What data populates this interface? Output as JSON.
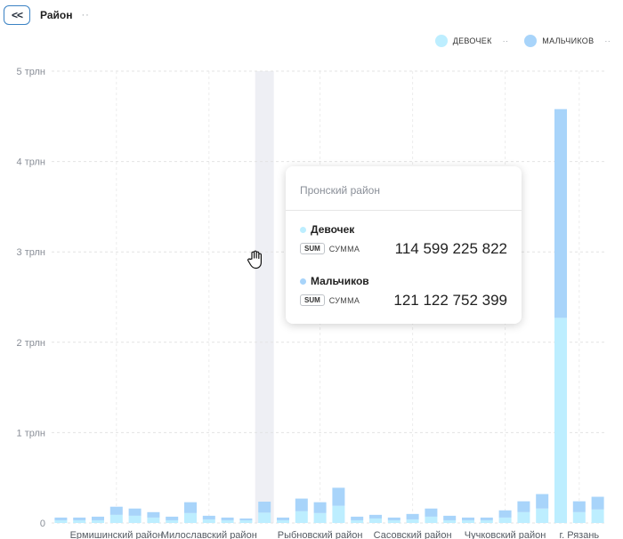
{
  "header": {
    "back_label": "<<",
    "title": "Район",
    "menu_dots": "··"
  },
  "legend": [
    {
      "name": "ДЕВОЧЕК",
      "color": "#bdeeff"
    },
    {
      "name": "МАЛЬЧИКОВ",
      "color": "#a8d4fa"
    }
  ],
  "legend_dots": "··",
  "tooltip": {
    "title": "Пронский район",
    "rows": [
      {
        "series": "Девочек",
        "badge": "SUM",
        "label": "СУММА",
        "value": "114 599 225 822",
        "color": "#bdeeff"
      },
      {
        "series": "Мальчиков",
        "badge": "SUM",
        "label": "СУММА",
        "value": "121 122 752 399",
        "color": "#a8d4fa"
      }
    ]
  },
  "chart_data": {
    "type": "bar",
    "stacked": true,
    "y_ticks": [
      "0",
      "1 трлн",
      "2 трлн",
      "3 трлн",
      "4 трлн",
      "5 трлн"
    ],
    "ylim": [
      0,
      5
    ],
    "y_unit": "трлн",
    "x_tick_labels": [
      "Ермишинский район",
      "Милославский район",
      "Рыбновский район",
      "Сасовский район",
      "Чучковский район",
      "г. Рязань"
    ],
    "x_tick_positions": [
      3,
      8,
      14,
      19,
      24,
      28
    ],
    "hovered_index": 11,
    "grid": true,
    "legend_position": "top-right",
    "series": [
      {
        "name": "ДЕВОЧЕК",
        "color": "#bdeeff",
        "values": [
          0.03,
          0.03,
          0.03,
          0.09,
          0.08,
          0.06,
          0.03,
          0.11,
          0.04,
          0.03,
          0.03,
          0.115,
          0.03,
          0.13,
          0.11,
          0.19,
          0.03,
          0.05,
          0.03,
          0.04,
          0.07,
          0.03,
          0.03,
          0.03,
          0.06,
          0.12,
          0.16,
          2.27,
          0.12,
          0.15
        ]
      },
      {
        "name": "МАЛЬЧИКОВ",
        "color": "#a8d4fa",
        "values": [
          0.03,
          0.03,
          0.04,
          0.09,
          0.08,
          0.06,
          0.04,
          0.12,
          0.04,
          0.03,
          0.02,
          0.121,
          0.03,
          0.14,
          0.12,
          0.2,
          0.04,
          0.04,
          0.03,
          0.06,
          0.09,
          0.05,
          0.03,
          0.03,
          0.08,
          0.12,
          0.16,
          2.31,
          0.12,
          0.14
        ]
      }
    ]
  }
}
